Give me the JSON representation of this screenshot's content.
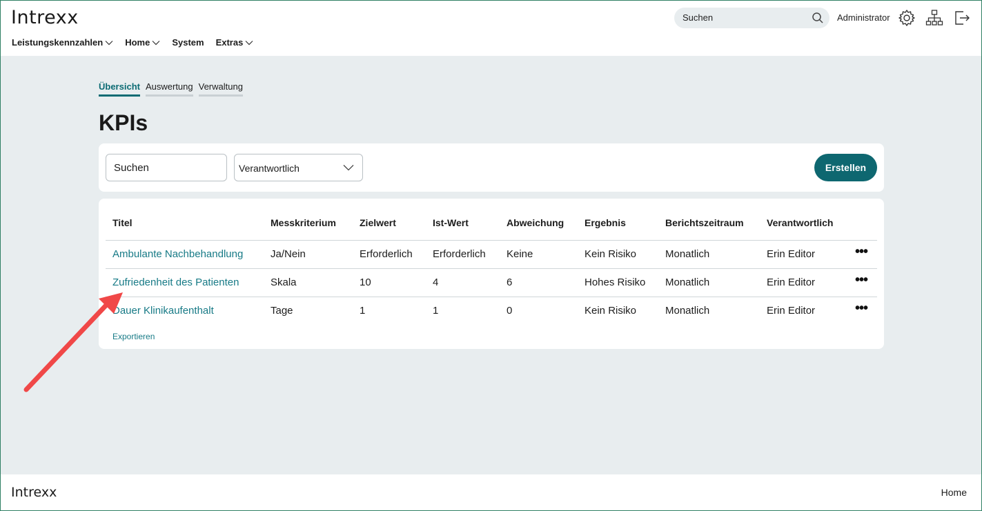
{
  "header": {
    "logo": "Intrexx",
    "search_placeholder": "Suchen",
    "user": "Administrator",
    "icons": [
      "gear-icon",
      "sitemap-icon",
      "logout-icon"
    ],
    "nav": [
      {
        "label": "Leistungskennzahlen",
        "dropdown": true
      },
      {
        "label": "Home",
        "dropdown": true
      },
      {
        "label": "System",
        "dropdown": false
      },
      {
        "label": "Extras",
        "dropdown": true
      }
    ]
  },
  "tabs": [
    {
      "label": "Übersicht",
      "active": true
    },
    {
      "label": "Auswertung",
      "active": false
    },
    {
      "label": "Verwaltung",
      "active": false
    }
  ],
  "page_title": "KPIs",
  "filters": {
    "search_value": "Suchen",
    "responsible_select": "Verantwortlich",
    "create_button": "Erstellen"
  },
  "table": {
    "columns": [
      "Titel",
      "Messkriterium",
      "Zielwert",
      "Ist-Wert",
      "Abweichung",
      "Ergebnis",
      "Berichtszeitraum",
      "Verantwortlich"
    ],
    "rows": [
      [
        "Ambulante Nachbehandlung",
        "Ja/Nein",
        "Erforderlich",
        "Erforderlich",
        "Keine",
        "Kein Risiko",
        "Monatlich",
        "Erin Editor"
      ],
      [
        "Zufriedenheit des Patienten",
        "Skala",
        "10",
        "4",
        "6",
        "Hohes Risiko",
        "Monatlich",
        "Erin Editor"
      ],
      [
        "Dauer Klinikaufenthalt",
        "Tage",
        "1",
        "1",
        "0",
        "Kein Risiko",
        "Monatlich",
        "Erin Editor"
      ]
    ],
    "row_menu": "•••",
    "export_link": "Exportieren"
  },
  "footer": {
    "logo": "Intrexx",
    "home_link": "Home"
  },
  "colors": {
    "accent": "#0e6770",
    "link": "#177a86",
    "annotation_arrow": "#f04848",
    "background": "#e8edef"
  }
}
